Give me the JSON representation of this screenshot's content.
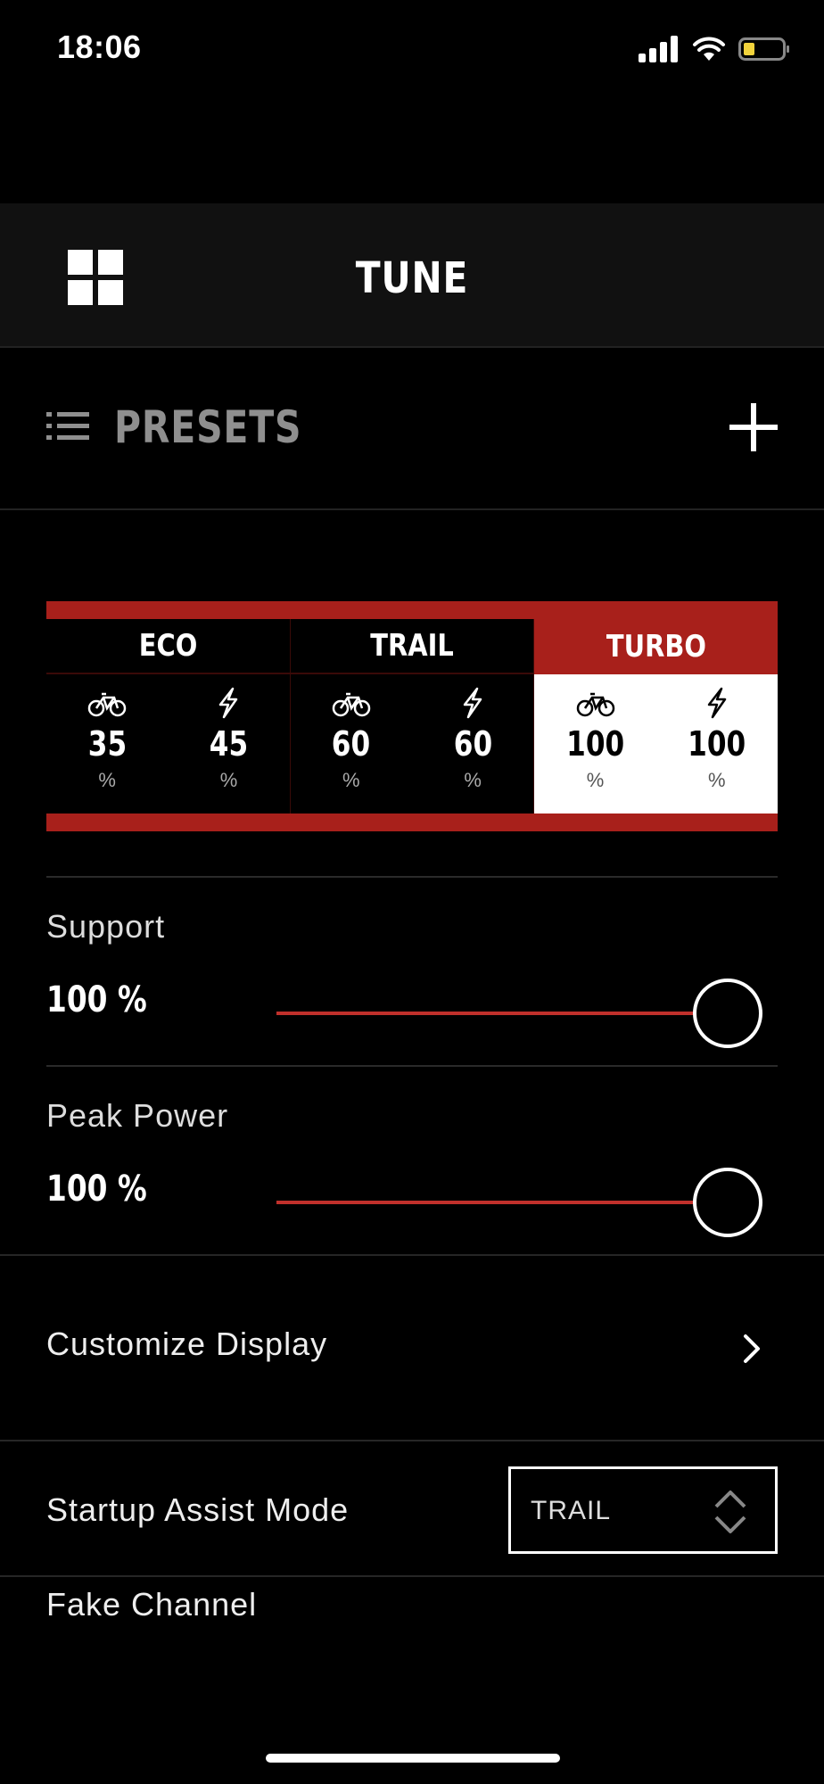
{
  "status": {
    "time": "18:06",
    "icons": [
      "signal-icon",
      "wifi-icon",
      "battery-icon"
    ]
  },
  "header": {
    "title": "TUNE",
    "menu_icon": "grid-icon"
  },
  "presets": {
    "label": "PRESETS",
    "list_icon": "list-icon",
    "add_icon": "plus-icon"
  },
  "modes": [
    {
      "name": "ECO",
      "support": "35",
      "power": "45",
      "unit": "%",
      "active": false
    },
    {
      "name": "TRAIL",
      "support": "60",
      "power": "60",
      "unit": "%",
      "active": false
    },
    {
      "name": "TURBO",
      "support": "100",
      "power": "100",
      "unit": "%",
      "active": true
    }
  ],
  "support": {
    "label": "Support",
    "value_text": "100 %",
    "level": 1.0
  },
  "peak_power": {
    "label": "Peak Power",
    "value_text": "100 %",
    "level": 1.0
  },
  "customize": {
    "label": "Customize Display",
    "icon": "chevron-right-icon"
  },
  "startup": {
    "label": "Startup Assist Mode",
    "value": "TRAIL"
  },
  "fake_channel": {
    "label": "Fake Channel"
  },
  "colors": {
    "accent": "#a8201b",
    "track": "#c0302b",
    "background": "#000000"
  }
}
